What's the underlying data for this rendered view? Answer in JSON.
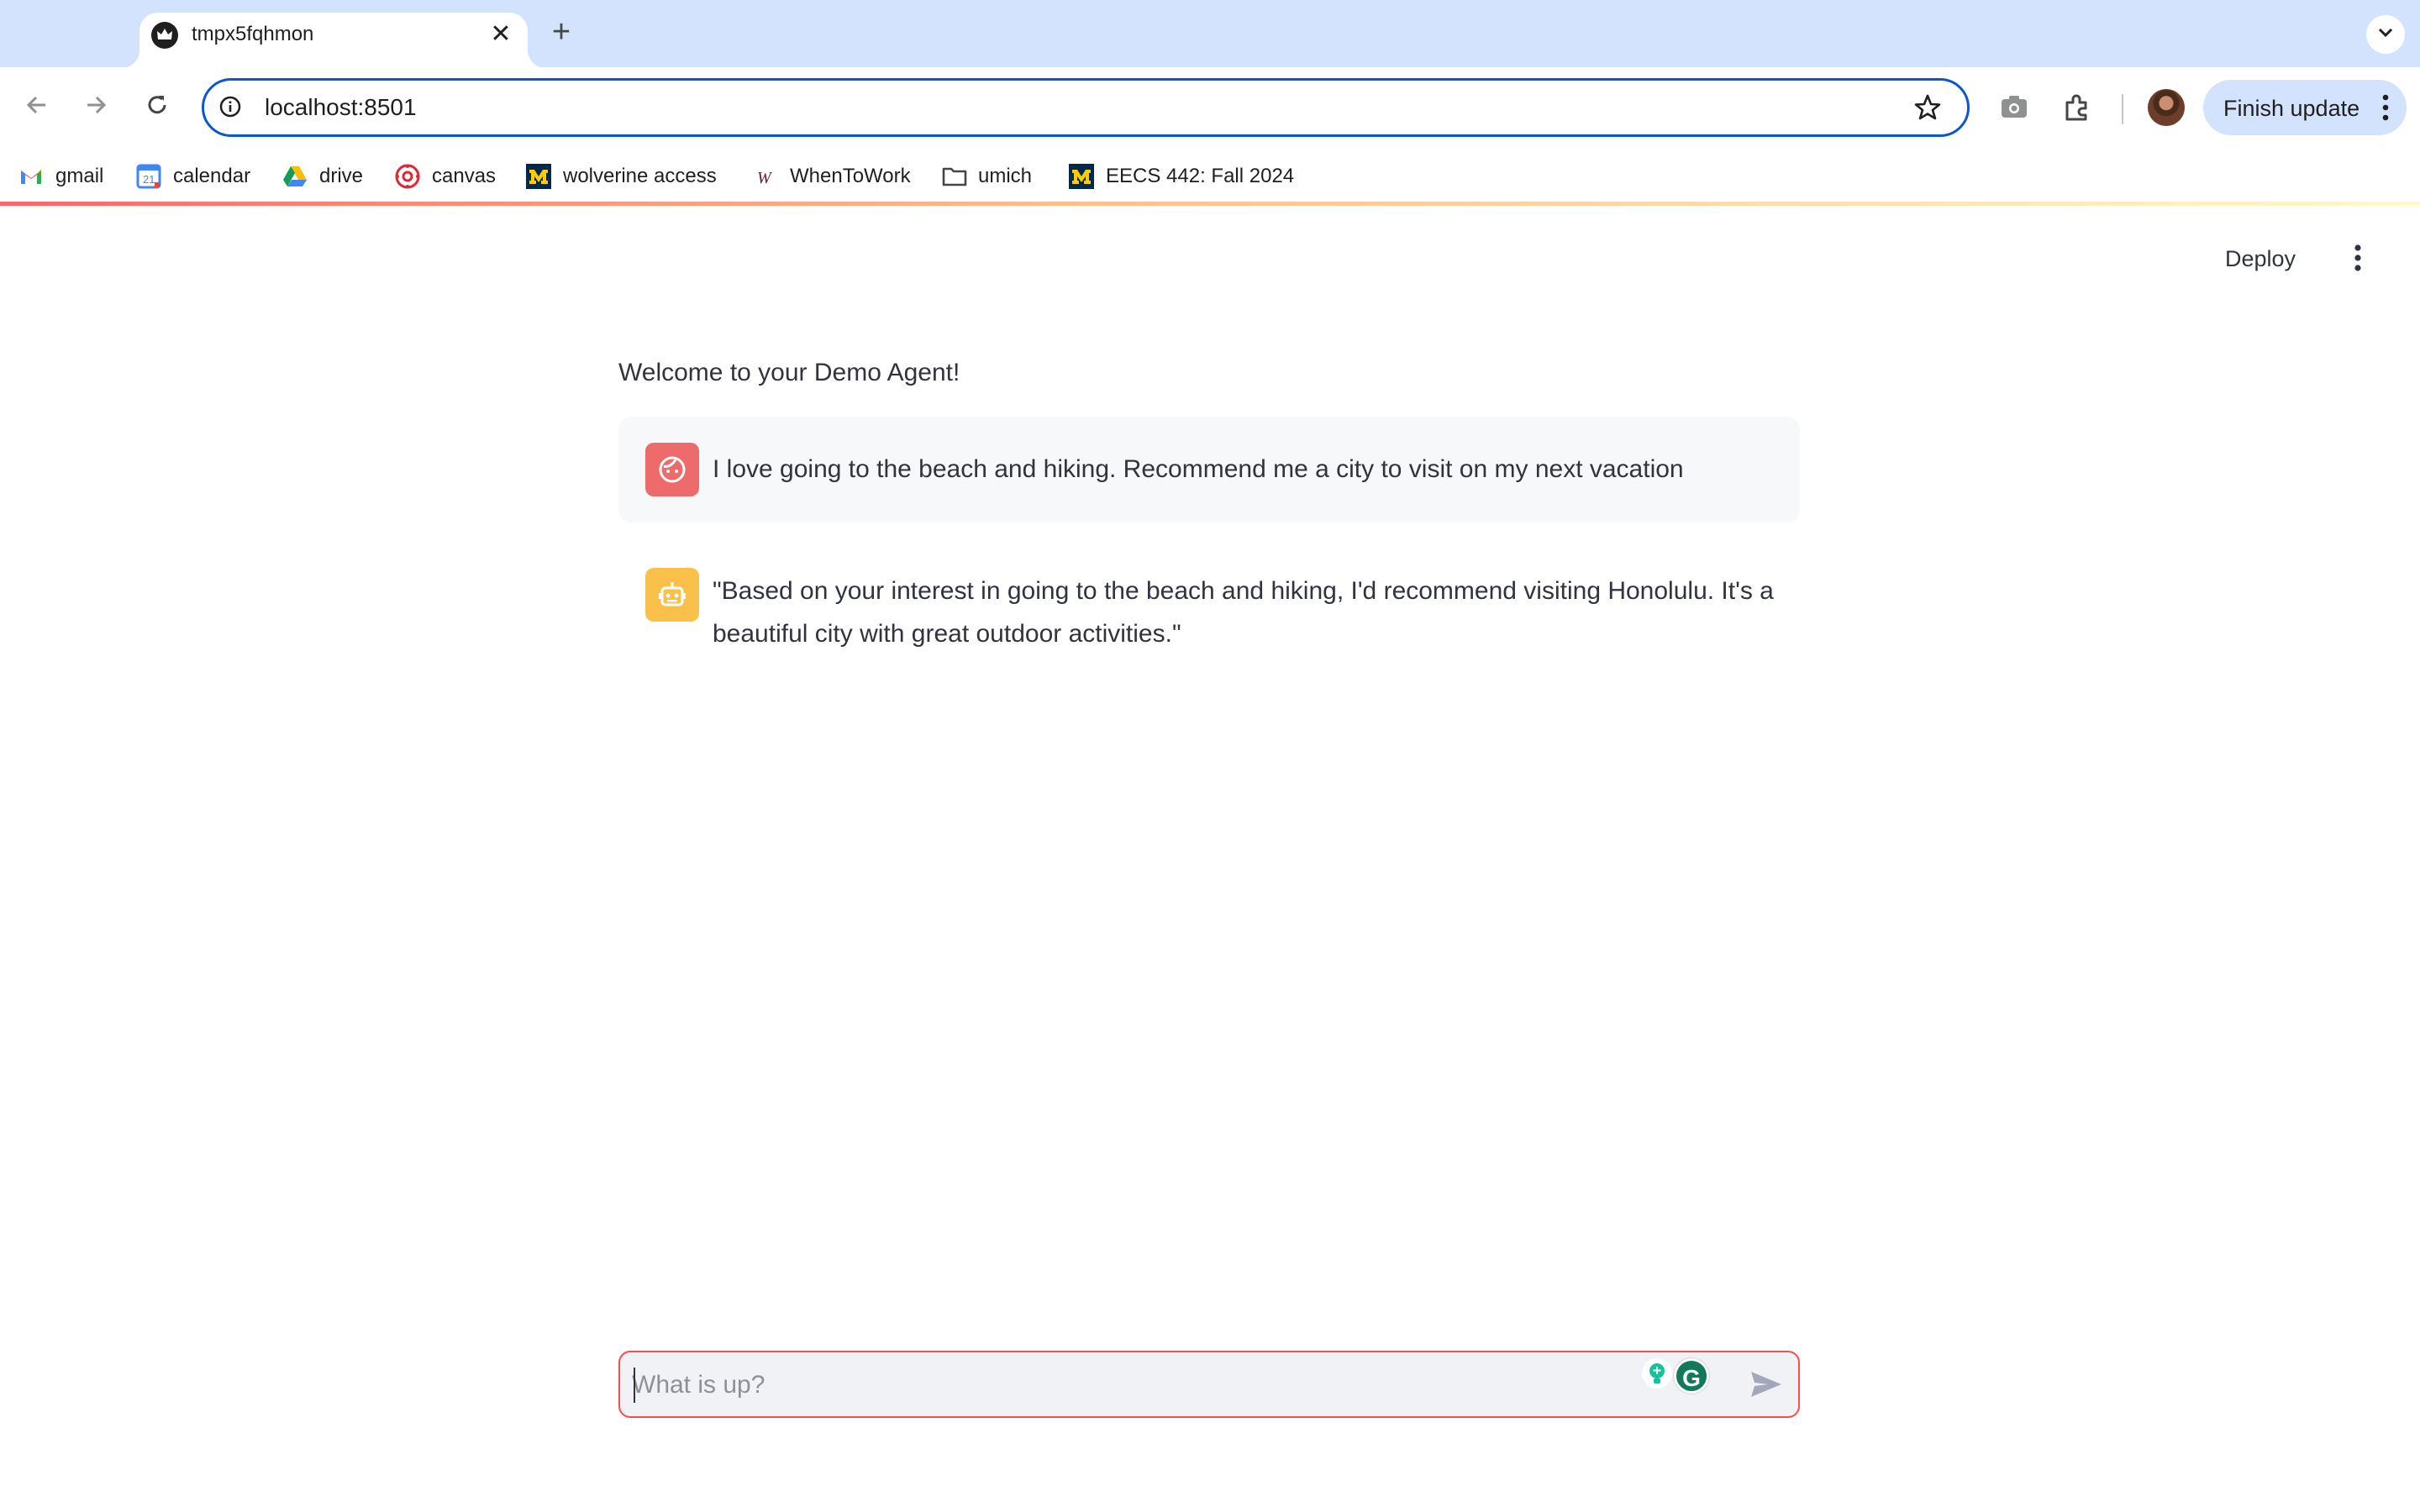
{
  "browser": {
    "tab": {
      "title": "tmpx5fqhmon",
      "close_glyph": "✕"
    },
    "new_tab_glyph": "+",
    "address": {
      "url": "localhost:8501"
    },
    "finish_update_label": "Finish update",
    "bookmarks": [
      {
        "label": "gmail",
        "icon": "gmail-icon"
      },
      {
        "label": "calendar",
        "icon": "calendar-icon"
      },
      {
        "label": "drive",
        "icon": "drive-icon"
      },
      {
        "label": "canvas",
        "icon": "canvas-icon"
      },
      {
        "label": "wolverine access",
        "icon": "umich-m-icon"
      },
      {
        "label": "WhenToWork",
        "icon": "whentowork-icon"
      },
      {
        "label": "umich",
        "icon": "folder-icon"
      },
      {
        "label": "EECS 442: Fall 2024",
        "icon": "umich-m-icon"
      }
    ],
    "calendar_icon_number": "21"
  },
  "app": {
    "deploy_label": "Deploy",
    "welcome": "Welcome to your Demo Agent!",
    "messages": [
      {
        "role": "user",
        "avatar_icon": "user-face-icon",
        "text": "I love going to the beach and hiking. Recommend me a city to visit on my next vacation"
      },
      {
        "role": "assistant",
        "avatar_icon": "robot-icon",
        "text": "\"Based on your interest in going to the beach and hiking, I'd recommend visiting Honolulu. It's a beautiful city with great outdoor activities.\""
      }
    ],
    "chat_input": {
      "placeholder": "What is up?",
      "value": ""
    },
    "grammarly_glyph": "G"
  },
  "colors": {
    "accent": "#ff4b4b",
    "user_avatar": "#ee6b6b",
    "assistant_avatar": "#f9c04a",
    "focus_blue": "#0b57d0",
    "tabstrip_bg": "#d3e3fd"
  }
}
